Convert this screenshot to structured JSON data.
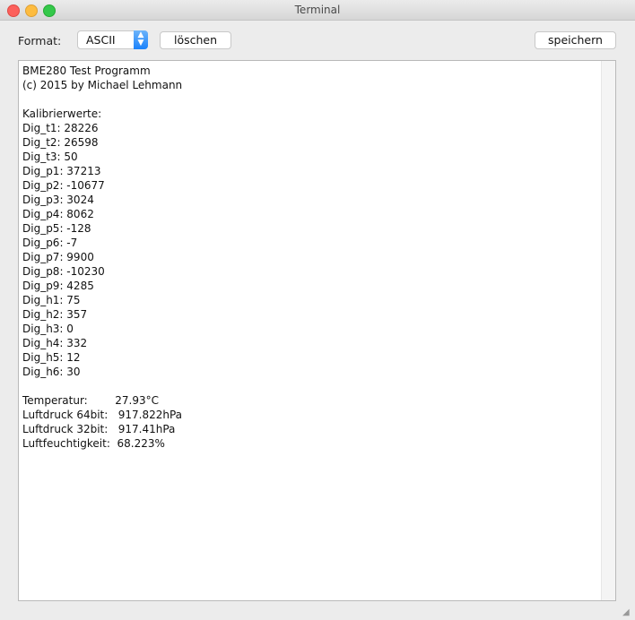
{
  "window": {
    "title": "Terminal"
  },
  "toolbar": {
    "format_label": "Format:",
    "format_value": "ASCII",
    "clear_label": "löschen",
    "save_label": "speichern"
  },
  "output": {
    "lines": [
      "BME280 Test Programm",
      "(c) 2015 by Michael Lehmann",
      "",
      "Kalibrierwerte:",
      "Dig_t1: 28226",
      "Dig_t2: 26598",
      "Dig_t3: 50",
      "Dig_p1: 37213",
      "Dig_p2: -10677",
      "Dig_p3: 3024",
      "Dig_p4: 8062",
      "Dig_p5: -128",
      "Dig_p6: -7",
      "Dig_p7: 9900",
      "Dig_p8: -10230",
      "Dig_p9: 4285",
      "Dig_h1: 75",
      "Dig_h2: 357",
      "Dig_h3: 0",
      "Dig_h4: 332",
      "Dig_h5: 12",
      "Dig_h6: 30",
      "",
      "Temperatur:        27.93°C",
      "Luftdruck 64bit:   917.822hPa",
      "Luftdruck 32bit:   917.41hPa",
      "Luftfeuchtigkeit:  68.223%"
    ]
  }
}
